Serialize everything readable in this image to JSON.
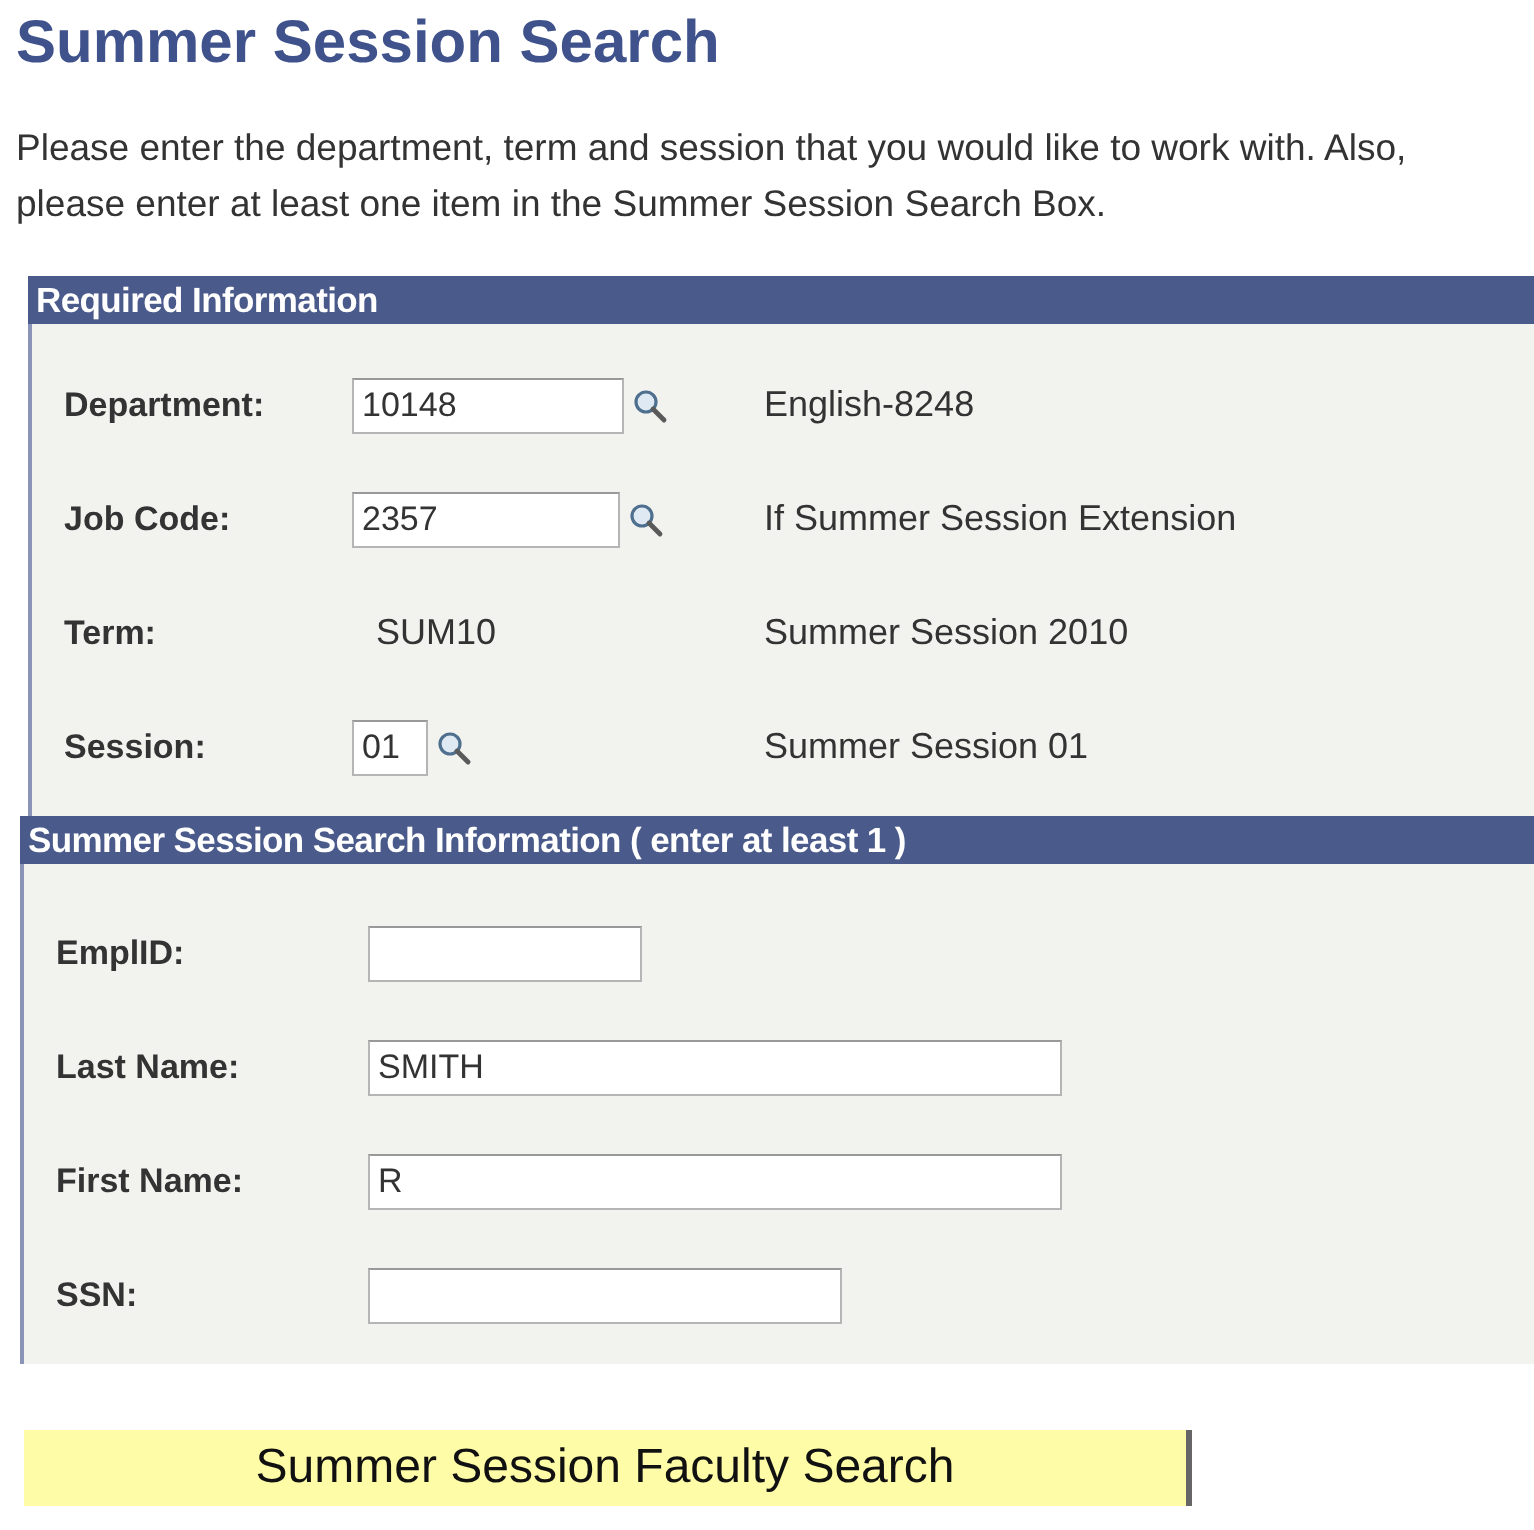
{
  "title": "Summer Session Search",
  "intro": "Please enter the department, term and session that you would like to work with. Also, please enter at least one item in the Summer Session Search Box.",
  "required": {
    "header": "Required Information",
    "rows": [
      {
        "kind": "lookup",
        "label": "Department:",
        "value": "10148",
        "description": "English-8248"
      },
      {
        "kind": "lookup",
        "label": "Job Code:",
        "value": "2357",
        "description": "If Summer Session Extension"
      },
      {
        "kind": "text",
        "label": "Term:",
        "value": "SUM10",
        "description": "Summer Session 2010"
      },
      {
        "kind": "lookup",
        "label": "Session:",
        "value": "01",
        "description": "Summer Session 01"
      }
    ]
  },
  "search": {
    "header": "Summer Session Search Information ( enter at least 1 )",
    "rows": [
      {
        "label": "EmplID:"
      },
      {
        "label": "Last Name:",
        "value": "SMITH"
      },
      {
        "label": "First Name:",
        "value": "R"
      },
      {
        "label": "SSN:"
      }
    ]
  },
  "button": "Summer Session Faculty Search"
}
